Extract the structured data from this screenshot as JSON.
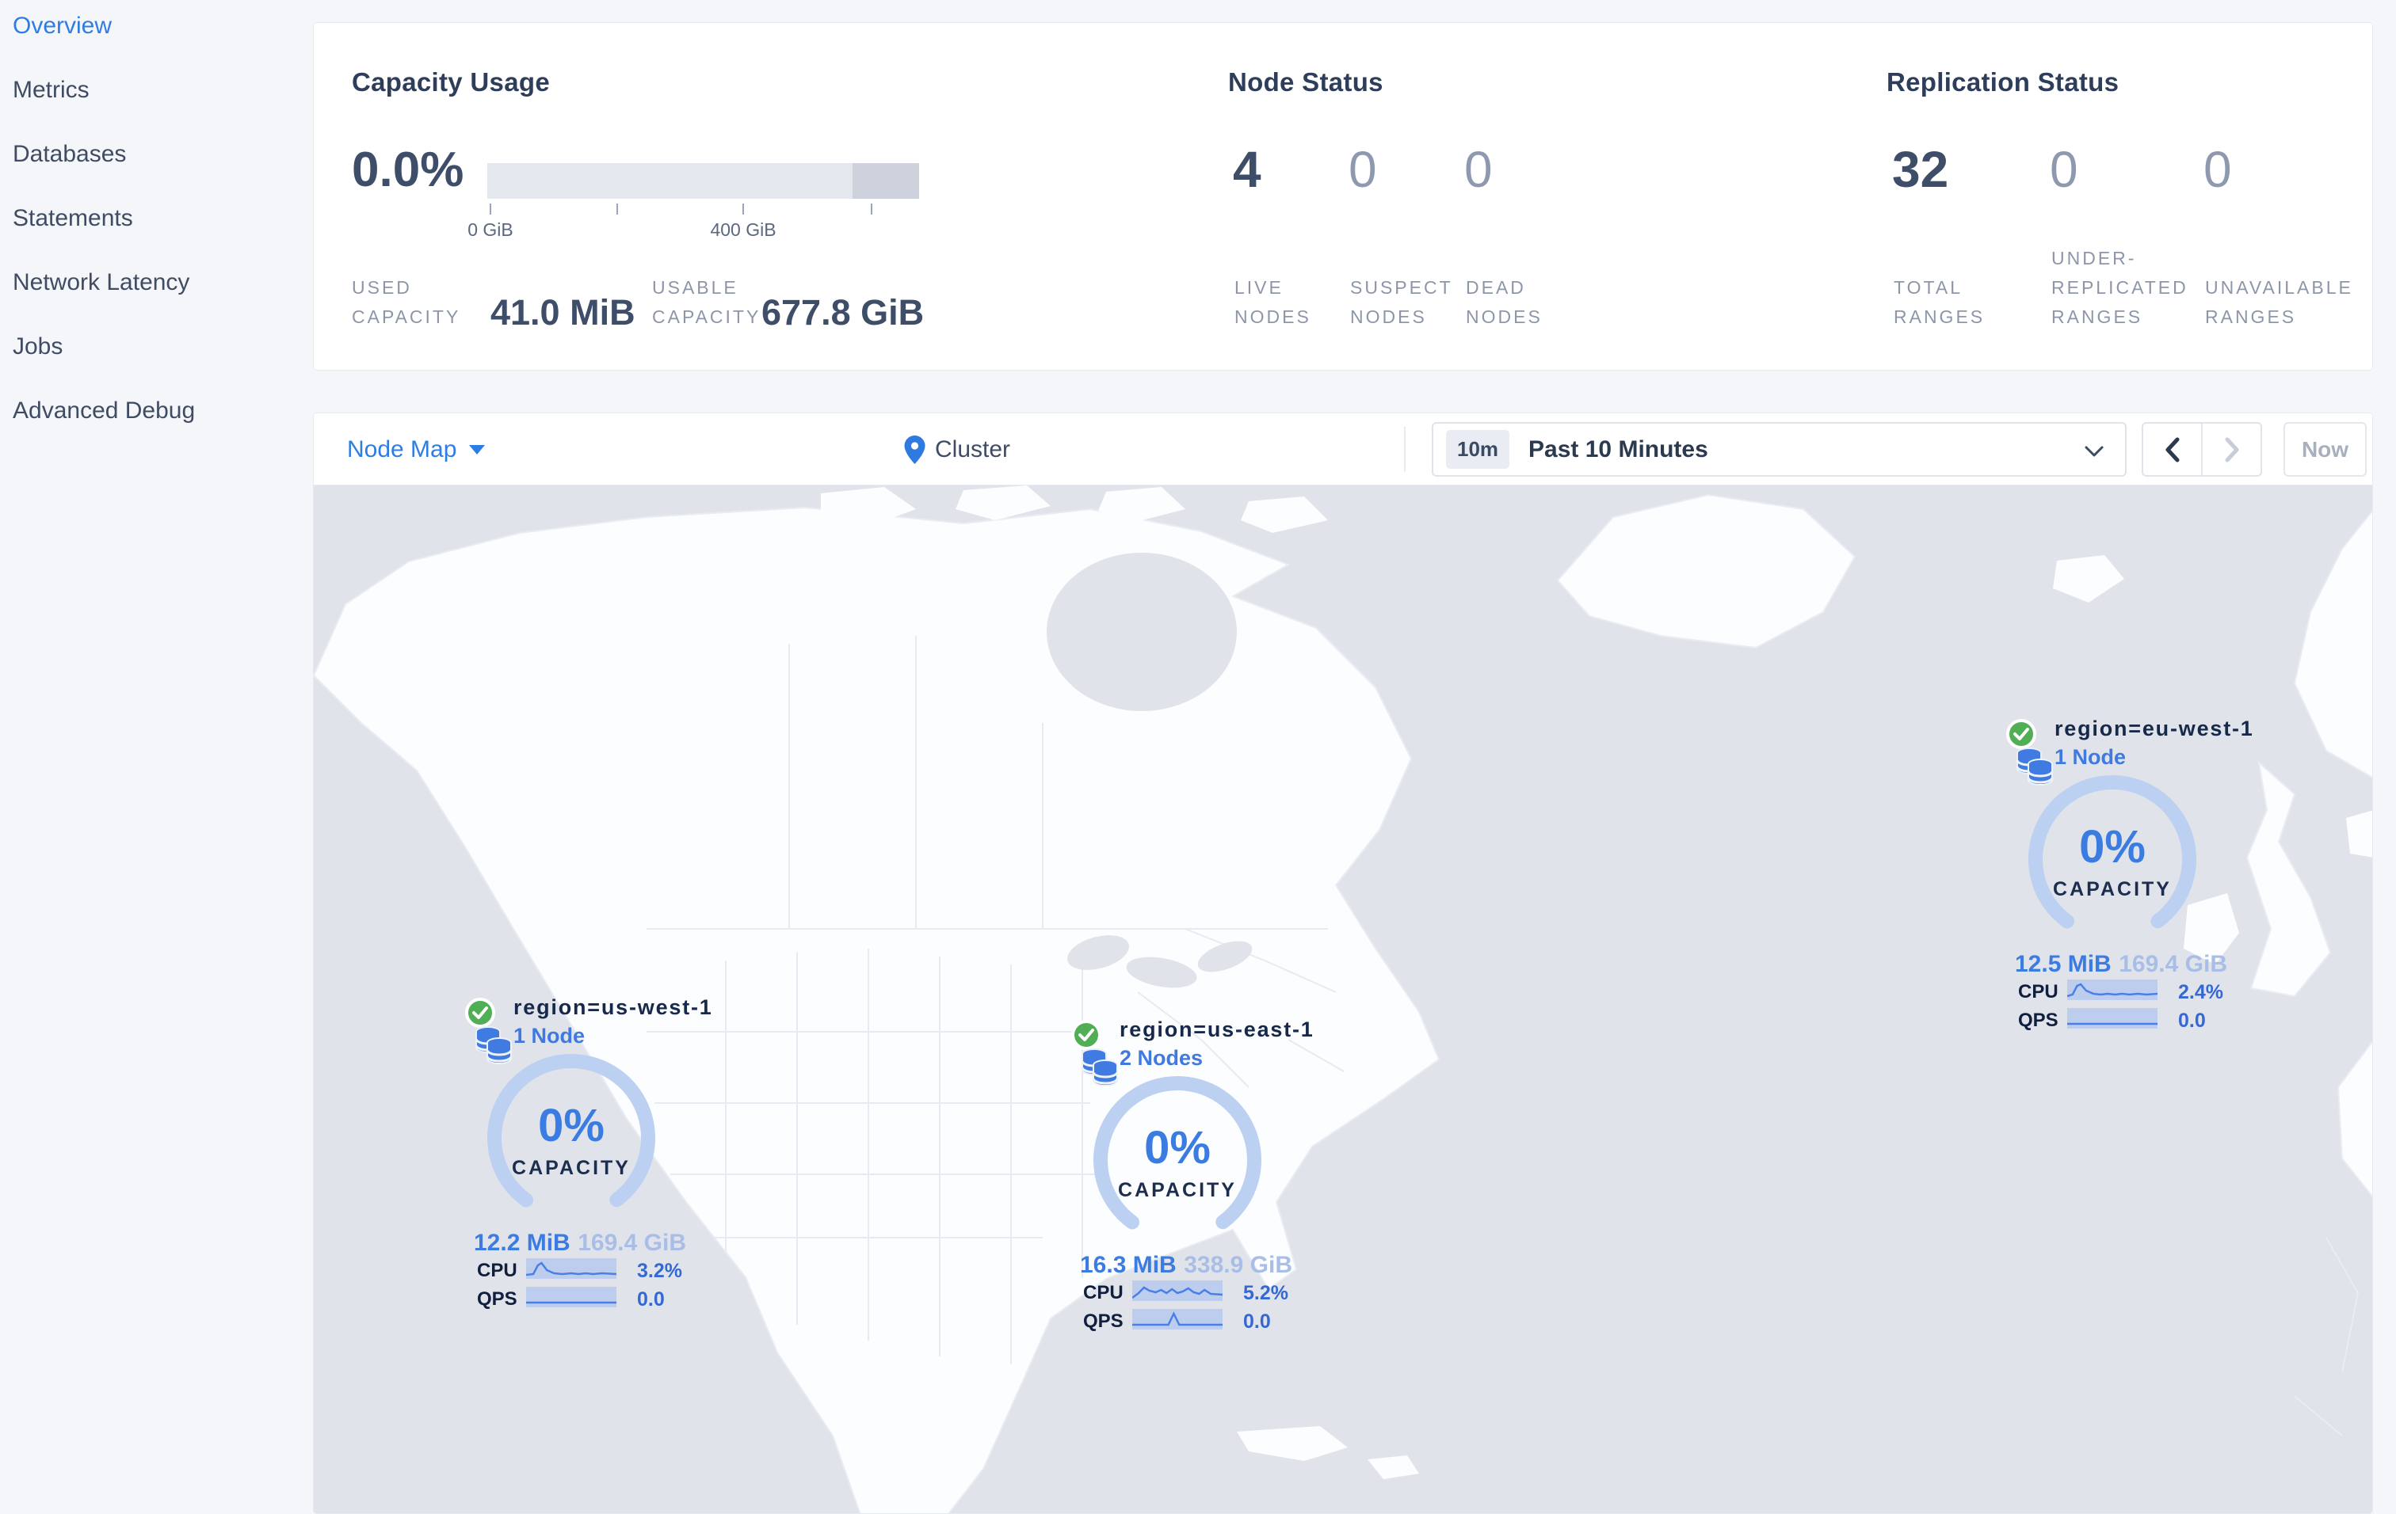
{
  "sidebar": {
    "items": [
      {
        "label": "Overview",
        "active": true
      },
      {
        "label": "Metrics",
        "active": false
      },
      {
        "label": "Databases",
        "active": false
      },
      {
        "label": "Statements",
        "active": false
      },
      {
        "label": "Network Latency",
        "active": false
      },
      {
        "label": "Jobs",
        "active": false
      },
      {
        "label": "Advanced Debug",
        "active": false
      }
    ]
  },
  "stats": {
    "capacity": {
      "title": "Capacity Usage",
      "percent": "0.0%",
      "tick_labels": [
        "0 GiB",
        "400 GiB"
      ],
      "bar": {
        "light_color": "#e4e7ed",
        "dark_color": "#cdd2dc",
        "dark_segment_pct": 15.5
      },
      "used_label": "USED CAPACITY",
      "used_value": "41.0 MiB",
      "usable_label": "USABLE CAPACITY",
      "usable_value": "677.8 GiB"
    },
    "node_status": {
      "title": "Node Status",
      "stats": [
        {
          "value": "4",
          "label": "LIVE NODES",
          "dim": false
        },
        {
          "value": "0",
          "label": "SUSPECT NODES",
          "dim": true
        },
        {
          "value": "0",
          "label": "DEAD NODES",
          "dim": true
        }
      ]
    },
    "replication": {
      "title": "Replication Status",
      "stats": [
        {
          "value": "32",
          "label": "TOTAL RANGES",
          "dim": false
        },
        {
          "value": "0",
          "label": "UNDER-REPLICATED RANGES",
          "dim": true
        },
        {
          "value": "0",
          "label": "UNAVAILABLE RANGES",
          "dim": true
        }
      ]
    }
  },
  "toolbar": {
    "view_label": "Node Map",
    "location_label": "Cluster",
    "time_badge": "10m",
    "time_range": "Past 10 Minutes",
    "now_label": "Now"
  },
  "map_markers": [
    {
      "region": "region=us-west-1",
      "nodes": "1 Node",
      "capacity_pct": "0%",
      "capacity_label": "CAPACITY",
      "used": "12.2 MiB",
      "total": "169.4 GiB",
      "cpu_label": "CPU",
      "cpu_value": "3.2%",
      "qps_label": "QPS",
      "qps_value": "0.0",
      "cpu_spark": [
        [
          0,
          21
        ],
        [
          8,
          20
        ],
        [
          13,
          9
        ],
        [
          17,
          6
        ],
        [
          23,
          15
        ],
        [
          31,
          19
        ],
        [
          40,
          20
        ],
        [
          50,
          19
        ],
        [
          58,
          20
        ],
        [
          66,
          19
        ],
        [
          74,
          20
        ],
        [
          84,
          19
        ],
        [
          100,
          20
        ]
      ],
      "qps_spark": [
        [
          0,
          20
        ],
        [
          100,
          20
        ]
      ]
    },
    {
      "region": "region=us-east-1",
      "nodes": "2 Nodes",
      "capacity_pct": "0%",
      "capacity_label": "CAPACITY",
      "used": "16.3 MiB",
      "total": "338.9 GiB",
      "cpu_label": "CPU",
      "cpu_value": "5.2%",
      "qps_label": "QPS",
      "qps_value": "0.0",
      "cpu_spark": [
        [
          0,
          22
        ],
        [
          7,
          16
        ],
        [
          13,
          9
        ],
        [
          19,
          13
        ],
        [
          26,
          15
        ],
        [
          32,
          12
        ],
        [
          38,
          16
        ],
        [
          44,
          11
        ],
        [
          50,
          16
        ],
        [
          56,
          14
        ],
        [
          62,
          10
        ],
        [
          68,
          15
        ],
        [
          74,
          17
        ],
        [
          80,
          12
        ],
        [
          87,
          17
        ],
        [
          100,
          18
        ]
      ],
      "qps_spark": [
        [
          0,
          20
        ],
        [
          40,
          20
        ],
        [
          46,
          6
        ],
        [
          52,
          20
        ],
        [
          100,
          20
        ]
      ]
    },
    {
      "region": "region=eu-west-1",
      "nodes": "1 Node",
      "capacity_pct": "0%",
      "capacity_label": "CAPACITY",
      "used": "12.5 MiB",
      "total": "169.4 GiB",
      "cpu_label": "CPU",
      "cpu_value": "2.4%",
      "qps_label": "QPS",
      "qps_value": "0.0",
      "cpu_spark": [
        [
          0,
          21
        ],
        [
          6,
          19
        ],
        [
          11,
          8
        ],
        [
          15,
          6
        ],
        [
          21,
          14
        ],
        [
          29,
          18
        ],
        [
          37,
          19
        ],
        [
          45,
          18
        ],
        [
          53,
          19
        ],
        [
          61,
          18
        ],
        [
          69,
          19
        ],
        [
          78,
          18
        ],
        [
          88,
          19
        ],
        [
          100,
          18
        ]
      ],
      "qps_spark": [
        [
          0,
          20
        ],
        [
          100,
          20
        ]
      ]
    }
  ],
  "colors": {
    "accent_blue": "#2e7de4",
    "link_blue": "#3a7ce2",
    "dark_text": "#2e3d59",
    "num_dark": "#3e4d68",
    "num_dim": "#8e99af",
    "label_gray": "#8d96a9",
    "ocean": "#e0e3ea",
    "land": "#fcfdfe",
    "green_check": "#50ae55",
    "gauge_arc": "#bcd0f1",
    "spark_band": "#bdcdee",
    "spark_line": "#4a7fe8",
    "total_dim_blue": "#a9bee6"
  }
}
